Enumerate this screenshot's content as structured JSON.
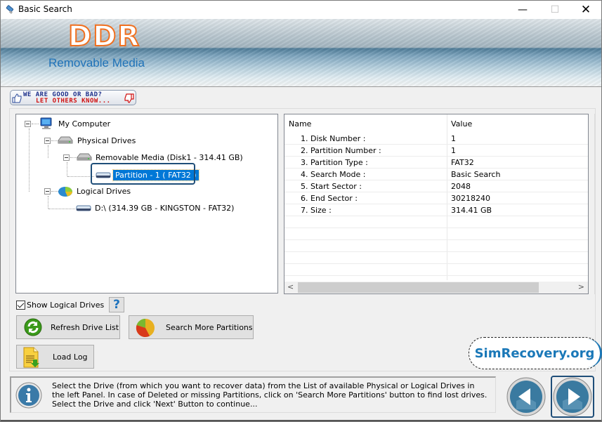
{
  "window": {
    "title": "Basic Search",
    "controls": {
      "minimize": "—",
      "maximize": "☐",
      "close": "✕"
    }
  },
  "banner": {
    "logo": "DDR",
    "subtitle": "Removable Media"
  },
  "rating": {
    "line1": "WE ARE GOOD OR BAD?",
    "line2": "LET OTHERS KNOW..."
  },
  "tree": {
    "root": "My Computer",
    "physical": "Physical Drives",
    "removable": "Removable Media (Disk1 - 314.41 GB)",
    "partition": "Partition - 1 ( FAT32 )",
    "logical": "Logical Drives",
    "drive_d": "D:\\ (314.39 GB - KINGSTON - FAT32)"
  },
  "details": {
    "headers": {
      "name": "Name",
      "value": "Value"
    },
    "rows": [
      {
        "name": "1. Disk Number :",
        "value": "1"
      },
      {
        "name": "2. Partition Number :",
        "value": "1"
      },
      {
        "name": "3. Partition Type :",
        "value": "FAT32"
      },
      {
        "name": "4. Search Mode :",
        "value": "Basic Search"
      },
      {
        "name": "5. Start Sector :",
        "value": "2048"
      },
      {
        "name": "6. End Sector :",
        "value": "30218240"
      },
      {
        "name": "7. Size :",
        "value": "314.41 GB"
      }
    ]
  },
  "controls": {
    "show_logical": "Show Logical Drives",
    "show_logical_checked": true,
    "help": "?",
    "refresh": "Refresh Drive List",
    "search_more": "Search More Partitions",
    "load_log": "Load Log"
  },
  "brand": "SimRecovery.org",
  "info_text": "Select the Drive (from which you want to recover data) from the List of available Physical or Logical Drives in the left Panel. In case of Deleted or missing Partitions, click on 'Search More Partitions' button to find lost drives. Select the Drive and click 'Next' Button to continue...",
  "colors": {
    "accent": "#0078d7",
    "logo_orange": "#f07020",
    "brand_blue": "#1a78b8",
    "subtitle_blue": "#1f72b8"
  }
}
